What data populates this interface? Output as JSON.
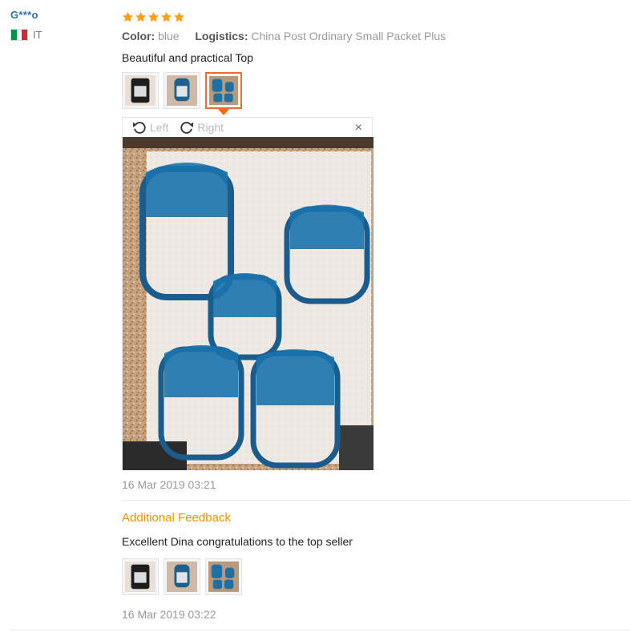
{
  "reviewer": {
    "name": "G***o",
    "country_code": "IT",
    "flag_colors": [
      "#009246",
      "#ffffff",
      "#ce2b37"
    ]
  },
  "review": {
    "rating": 5,
    "rating_max": 5,
    "star_color": "#ff9f1a",
    "color_label": "Color:",
    "color_value": "blue",
    "logistics_label": "Logistics:",
    "logistics_value": "China Post Ordinary Small Packet Plus",
    "text": "Beautiful and practical Top",
    "thumbnails": [
      "photo-thumbnail-1",
      "photo-thumbnail-2",
      "photo-thumbnail-3"
    ],
    "active_thumbnail": 3,
    "date": "16 Mar 2019 03:21"
  },
  "viewer": {
    "rotate_left_label": "Left",
    "rotate_right_label": "Right",
    "close_glyph": "×"
  },
  "additional": {
    "title": "Additional Feedback",
    "text": "Excellent Dina congratulations to the top seller",
    "thumbnails": [
      "photo-thumbnail-1",
      "photo-thumbnail-2",
      "photo-thumbnail-3"
    ],
    "date": "16 Mar 2019 03:22"
  },
  "colors": {
    "accent_orange": "#f39200",
    "active_border": "#e2703f",
    "username_blue": "#2a6fb6"
  }
}
